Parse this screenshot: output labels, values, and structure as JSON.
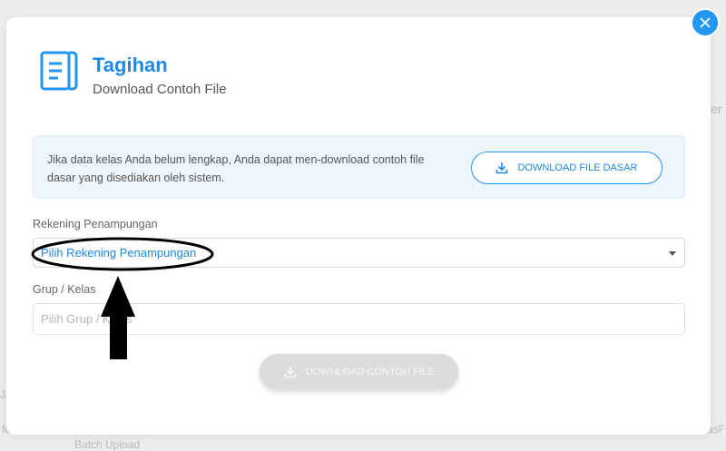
{
  "modal": {
    "title": "Tagihan",
    "subtitle": "Download Contoh File",
    "info": {
      "text": "Jika data kelas Anda belum lengkap, Anda dapat men-download contoh file dasar yang disediakan oleh sistem.",
      "button_label": "DOWNLOAD FILE DASAR"
    },
    "rekening": {
      "label": "Rekening Penampungan",
      "selected": "Pilih Rekening Penampungan"
    },
    "grup": {
      "label": "Grup / Kelas",
      "placeholder": "Pilih Grup / Kelas"
    },
    "submit_label": "DOWNLOAD CONTOH FILE"
  },
  "background": {
    "fragment_right": "er",
    "fragment_left": "J",
    "fragment_bottom_left": "fo",
    "fragment_bottom": "Batch Upload",
    "fragment_bottom_right": "asF"
  },
  "colors": {
    "accent": "#2196f3",
    "annotation": "#000000"
  },
  "icons": {
    "close": "close-icon",
    "document": "document-icon",
    "download": "download-icon",
    "caret": "caret-down-icon"
  }
}
